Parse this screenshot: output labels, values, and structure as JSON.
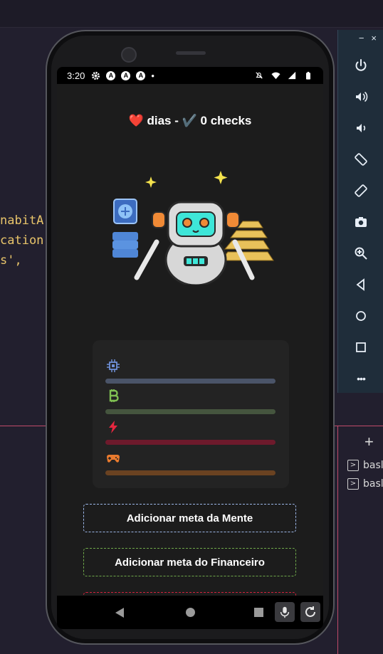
{
  "editor": {
    "code_lines": [
      "nabitAr",
      "cation",
      "s',"
    ]
  },
  "emulator_panel": {
    "minimize_label": "−",
    "close_label": "×",
    "buttons": [
      "power-icon",
      "volume-up-icon",
      "volume-down-icon",
      "rotate-left-icon",
      "rotate-right-icon",
      "screenshot-icon",
      "zoom-icon",
      "back-icon",
      "home-icon",
      "overview-icon",
      "more-icon"
    ],
    "more_label": "•••"
  },
  "terminal": {
    "add_label": "+",
    "sessions": [
      "basl",
      "basl"
    ]
  },
  "status_bar": {
    "time": "3:20",
    "app_badges": [
      "A",
      "A",
      "A"
    ],
    "dot": "•"
  },
  "app": {
    "header": {
      "heart": "❤️",
      "days_label": "dias -",
      "check": "✔️",
      "checks_label": "0 checks"
    },
    "stats": [
      {
        "icon": "chip-icon",
        "color": "#4a5468",
        "accent": "#6e8fd6"
      },
      {
        "icon": "bitcoin-icon",
        "color": "#45553e",
        "accent": "#7fbf52"
      },
      {
        "icon": "lightning-icon",
        "color": "#6e1a2c",
        "accent": "#e5273f"
      },
      {
        "icon": "gamepad-icon",
        "color": "#6a4221",
        "accent": "#e97a2e"
      }
    ],
    "goal_buttons": [
      {
        "label": "Adicionar meta da Mente",
        "color": "#9cb6e8"
      },
      {
        "label": "Adicionar meta do Financeiro",
        "color": "#6fa94a"
      },
      {
        "label": "",
        "color": "#d2213c"
      }
    ]
  }
}
